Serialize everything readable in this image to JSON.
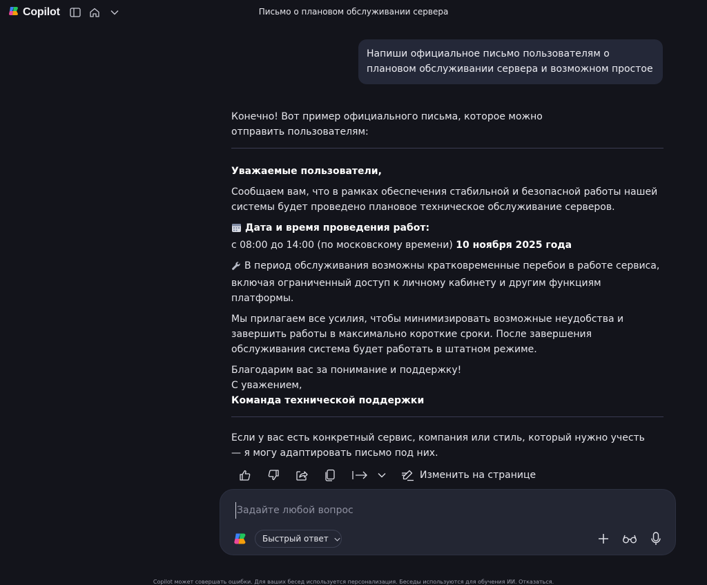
{
  "app": {
    "brand": "Copilot",
    "chat_title": "Письмо о плановом обслуживании сервера"
  },
  "user_message": "Напиши официальное письмо пользователям о плановом обслуживании сервера и возможном простое",
  "response": {
    "intro": "Конечно! Вот пример официального письма, которое можно отправить пользователям:",
    "greeting": "Уважаемые пользователи,",
    "para1": "Сообщаем вам, что в рамках обеспечения стабильной и безопасной работы нашей системы будет проведено плановое техническое обслуживание серверов.",
    "date_heading": "Дата и время проведения работ:",
    "time_text": "с 08:00 до 14:00 (по московскому времени) ",
    "date_bold": "10 ноября 2025 года",
    "para2": "В период обслуживания возможны кратковременные перебои в работе сервиса, включая ограниченный доступ к личному кабинету и другим функциям платформы.",
    "para3": "Мы прилагаем все усилия, чтобы минимизировать возможные неудобства и завершить работы в максимально короткие сроки. После завершения обслуживания система будет работать в штатном режиме.",
    "thanks": "Благодарим вас за понимание и поддержку!",
    "regards": "С уважением,",
    "signature": "Команда технической поддержки",
    "followup": "Если у вас есть конкретный сервис, компания или стиль, который нужно учесть — я могу адаптировать письмо под них."
  },
  "actions": {
    "edit_label": "Изменить на странице"
  },
  "composer": {
    "placeholder": "Задайте любой вопрос",
    "mode_label": "Быстрый ответ"
  },
  "footer": "Copilot может совершать ошибки. Для ваших бесед используется персонализация. Беседы используются для обучения ИИ. Отказаться.",
  "colors": {
    "background": "#13141b",
    "user_bubble": "#242838",
    "composer": "#232633"
  }
}
